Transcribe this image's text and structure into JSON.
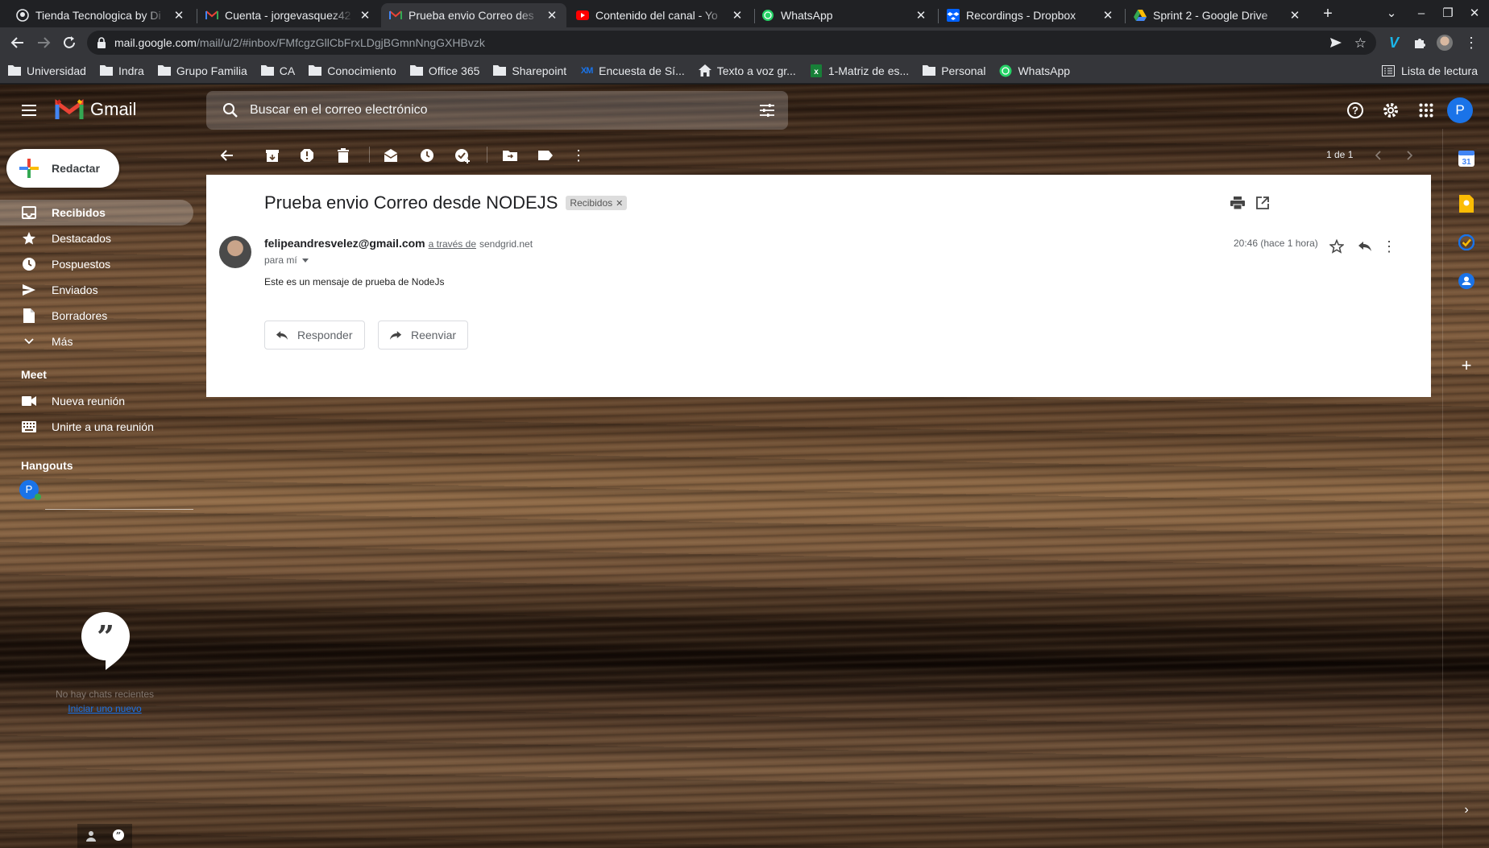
{
  "browser": {
    "tabs": [
      {
        "title": "Tienda Tecnologica by Di",
        "icon": "github-icon",
        "active": false
      },
      {
        "title": "Cuenta - jorgevasquez42",
        "icon": "gmail-icon",
        "active": false
      },
      {
        "title": "Prueba envio Correo des",
        "icon": "gmail-icon",
        "active": true
      },
      {
        "title": "Contenido del canal - Yo",
        "icon": "youtube-icon",
        "active": false
      },
      {
        "title": "WhatsApp",
        "icon": "whatsapp-icon",
        "active": false
      },
      {
        "title": "Recordings - Dropbox",
        "icon": "dropbox-icon",
        "active": false
      },
      {
        "title": "Sprint 2 - Google Drive",
        "icon": "drive-icon",
        "active": false
      }
    ],
    "url_host": "mail.google.com",
    "url_path": "/mail/u/2/#inbox/FMfcgzGllCbFrxLDgjBGmnNngGXHBvzk",
    "bookmarks": [
      {
        "label": "Universidad",
        "icon": "folder-icon"
      },
      {
        "label": "Indra",
        "icon": "folder-icon"
      },
      {
        "label": "Grupo Familia",
        "icon": "folder-icon"
      },
      {
        "label": "CA",
        "icon": "folder-icon"
      },
      {
        "label": "Conocimiento",
        "icon": "folder-icon"
      },
      {
        "label": "Office 365",
        "icon": "folder-icon"
      },
      {
        "label": "Sharepoint",
        "icon": "folder-icon"
      },
      {
        "label": "Encuesta de Sí...",
        "icon": "xm-icon"
      },
      {
        "label": "Texto a voz gr...",
        "icon": "home-icon"
      },
      {
        "label": "1-Matriz de es...",
        "icon": "sheets-icon"
      },
      {
        "label": "Personal",
        "icon": "folder-icon"
      },
      {
        "label": "WhatsApp",
        "icon": "whatsapp-icon"
      }
    ],
    "reading_list": "Lista de lectura"
  },
  "gmail": {
    "logo_text": "Gmail",
    "search_placeholder": "Buscar en el correo electrónico",
    "avatar_letter": "P",
    "compose_label": "Redactar",
    "nav": [
      {
        "label": "Recibidos",
        "icon": "inbox-icon",
        "active": true
      },
      {
        "label": "Destacados",
        "icon": "star-icon",
        "active": false
      },
      {
        "label": "Pospuestos",
        "icon": "clock-icon",
        "active": false
      },
      {
        "label": "Enviados",
        "icon": "send-icon",
        "active": false
      },
      {
        "label": "Borradores",
        "icon": "draft-icon",
        "active": false
      },
      {
        "label": "Más",
        "icon": "chevron-down-icon",
        "active": false
      }
    ],
    "meet": {
      "title": "Meet",
      "items": [
        {
          "label": "Nueva reunión",
          "icon": "video-icon"
        },
        {
          "label": "Unirte a una reunión",
          "icon": "keyboard-icon"
        }
      ]
    },
    "hangouts": {
      "title": "Hangouts",
      "avatar_letter": "P",
      "no_chats": "No hay chats recientes",
      "start_new": "Iniciar uno nuevo"
    },
    "pager": "1 de 1",
    "message": {
      "subject": "Prueba envio Correo desde NODEJS",
      "label": "Recibidos",
      "from": "felipeandresvelez@gmail.com",
      "via_text": "a través de",
      "via_domain": "sendgrid.net",
      "to": "para mí",
      "time": "20:46 (hace 1 hora)",
      "body": "Este es un mensaje de prueba de NodeJs",
      "reply_label": "Responder",
      "forward_label": "Reenviar"
    }
  }
}
